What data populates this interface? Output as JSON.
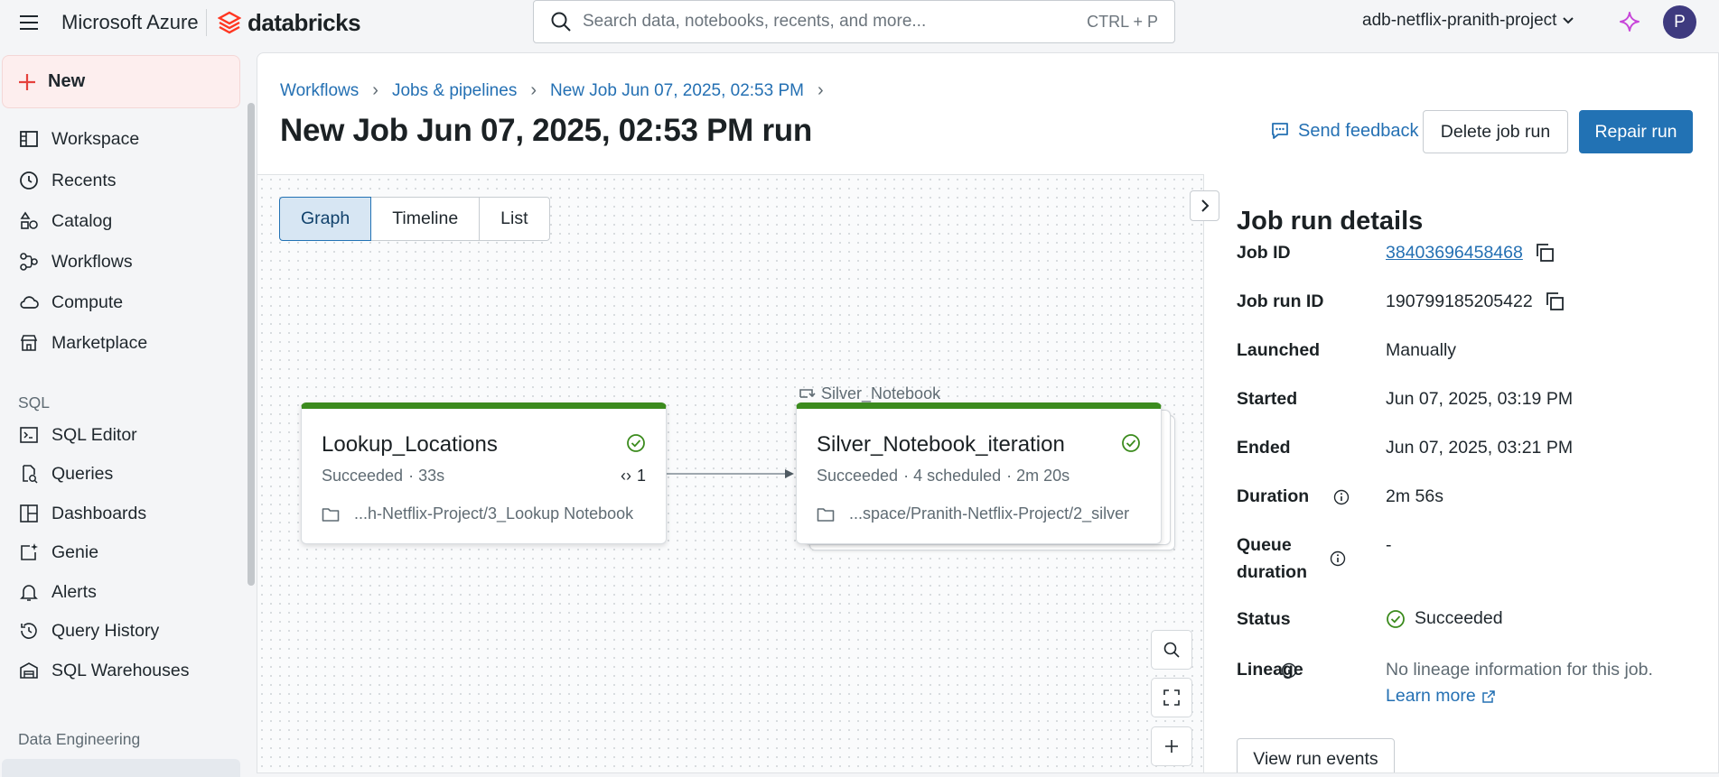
{
  "topbar": {
    "azure_label": "Microsoft Azure",
    "brand_label": "databricks",
    "search_placeholder": "Search data, notebooks, recents, and more...",
    "search_shortcut": "CTRL + P",
    "workspace": "adb-netflix-pranith-project",
    "avatar_initial": "P"
  },
  "sidebar": {
    "new_label": "New",
    "items": [
      {
        "label": "Workspace",
        "icon": "workspace-icon"
      },
      {
        "label": "Recents",
        "icon": "clock-icon"
      },
      {
        "label": "Catalog",
        "icon": "catalog-icon"
      },
      {
        "label": "Workflows",
        "icon": "workflows-icon"
      },
      {
        "label": "Compute",
        "icon": "cloud-icon"
      },
      {
        "label": "Marketplace",
        "icon": "store-icon"
      }
    ],
    "sql_section": "SQL",
    "sql_items": [
      {
        "label": "SQL Editor",
        "icon": "sql-editor-icon"
      },
      {
        "label": "Queries",
        "icon": "queries-icon"
      },
      {
        "label": "Dashboards",
        "icon": "dashboard-icon"
      },
      {
        "label": "Genie",
        "icon": "genie-icon"
      },
      {
        "label": "Alerts",
        "icon": "bell-icon"
      },
      {
        "label": "Query History",
        "icon": "history-icon"
      },
      {
        "label": "SQL Warehouses",
        "icon": "warehouse-icon"
      }
    ],
    "de_section": "Data Engineering"
  },
  "breadcrumb": [
    "Workflows",
    "Jobs & pipelines",
    "New Job Jun 07, 2025, 02:53 PM"
  ],
  "page_title": "New Job Jun 07, 2025, 02:53 PM run",
  "actions": {
    "feedback": "Send feedback",
    "delete": "Delete job run",
    "repair": "Repair run"
  },
  "view_tabs": [
    "Graph",
    "Timeline",
    "List"
  ],
  "active_tab": "Graph",
  "graph": {
    "tasks": [
      {
        "name": "Lookup_Locations",
        "status": "Succeeded",
        "duration": "· 33s",
        "iterations": "1",
        "path": "...h-Netflix-Project/3_Lookup Notebook"
      },
      {
        "name": "Silver_Notebook_iteration",
        "status": "Succeeded",
        "scheduled": "· 4 scheduled",
        "duration": "· 2m 20s",
        "path": "...space/Pranith-Netflix-Project/2_silver",
        "loop_parent": "Silver_Notebook"
      }
    ],
    "status_color": "#3b8b1d"
  },
  "details": {
    "title": "Job run details",
    "job_id_label": "Job ID",
    "job_id": "38403696458468",
    "run_id_label": "Job run ID",
    "run_id": "190799185205422",
    "launched_label": "Launched",
    "launched": "Manually",
    "started_label": "Started",
    "started": "Jun 07, 2025, 03:19 PM",
    "ended_label": "Ended",
    "ended": "Jun 07, 2025, 03:21 PM",
    "duration_label": "Duration",
    "duration": "2m 56s",
    "queue_label_1": "Queue",
    "queue_label_2": "duration",
    "queue": "-",
    "status_label": "Status",
    "status": "Succeeded",
    "lineage_label": "Lineage",
    "lineage": "No lineage information for this job.",
    "learn_more": "Learn more",
    "view_events": "View run events"
  },
  "colors": {
    "accent": "#2272b4",
    "link": "#2470b3",
    "success": "#3b8b1d",
    "brand": "#ff3621"
  }
}
